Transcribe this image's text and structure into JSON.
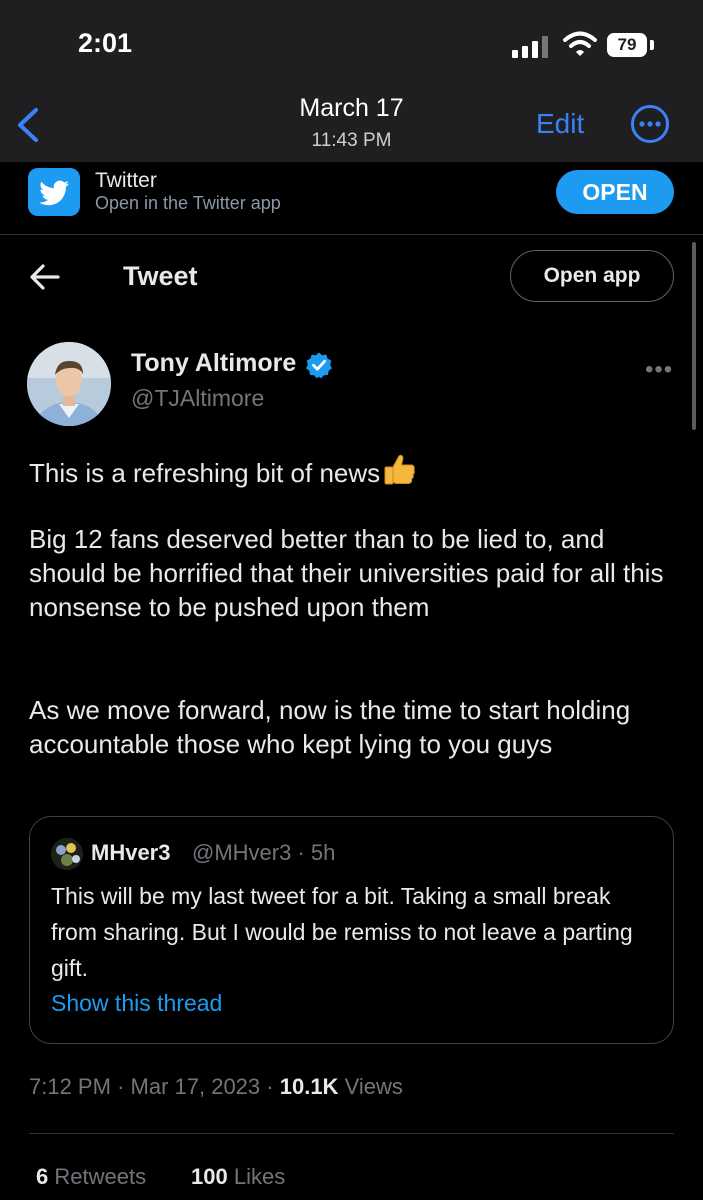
{
  "status_bar": {
    "time": "2:01",
    "battery": "79"
  },
  "nav": {
    "date": "March 17",
    "time": "11:43 PM",
    "edit_label": "Edit"
  },
  "banner": {
    "title": "Twitter",
    "subtitle": "Open in the Twitter app",
    "open_label": "OPEN"
  },
  "header": {
    "title": "Tweet",
    "open_app_label": "Open app"
  },
  "author": {
    "name": "Tony Altimore",
    "handle": "@TJAltimore",
    "verified": true
  },
  "tweet": {
    "line1": "This is a refreshing bit of news",
    "para2": "Big 12 fans deserved better than to be lied to, and should be horrified that their universities paid for all this nonsense to be pushed upon them",
    "para3": "As we move forward, now is the time to start holding accountable those who kept lying to you guys",
    "emoji": "thumbs-up-icon"
  },
  "quote": {
    "name": "MHver3",
    "handle": "@MHver3",
    "separator": "·",
    "age": "5h",
    "text": "This will be my last tweet for a bit. Taking a small break from sharing. But I would be remiss to not leave a parting gift.",
    "thread_label": "Show this thread"
  },
  "meta": {
    "time": "7:12 PM",
    "date": "Mar 17, 2023",
    "separator": "·",
    "views_count": "10.1K",
    "views_label": "Views"
  },
  "stats": {
    "retweets_count": "6",
    "retweets_label": "Retweets",
    "likes_count": "100",
    "likes_label": "Likes"
  },
  "colors": {
    "accent": "#1d9bf0",
    "ios_blue": "#3a82f7",
    "muted": "#71767b",
    "background": "#000000"
  }
}
